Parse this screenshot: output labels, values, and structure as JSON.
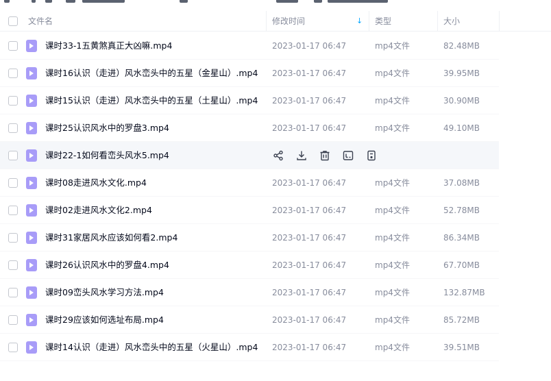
{
  "header": {
    "name_label": "文件名",
    "date_label": "修改时间",
    "sort_arrow": "↓",
    "type_label": "类型",
    "size_label": "大小"
  },
  "colors": {
    "accent": "#06a7ff",
    "video_icon": "#a89cf8",
    "row_hover": "#f5f7fa"
  },
  "hover_row_index": 4,
  "hover_actions": [
    "share-icon",
    "download-icon",
    "delete-icon",
    "rename-icon",
    "more-icon"
  ],
  "rows": [
    {
      "name": "课时33-1五黄煞真正大凶嘛.mp4",
      "date": "2023-01-17 06:47",
      "type": "mp4文件",
      "size": "82.48MB"
    },
    {
      "name": "课时16认识（走进）风水峦头中的五星（金星山）.mp4",
      "date": "2023-01-17 06:47",
      "type": "mp4文件",
      "size": "39.95MB"
    },
    {
      "name": "课时15认识（走进）风水峦头中的五星（土星山）.mp4",
      "date": "2023-01-17 06:47",
      "type": "mp4文件",
      "size": "30.90MB"
    },
    {
      "name": "课时25认识风水中的罗盘3.mp4",
      "date": "2023-01-17 06:47",
      "type": "mp4文件",
      "size": "49.10MB"
    },
    {
      "name": "课时22-1如何看峦头风水5.mp4",
      "date": "",
      "type": "",
      "size": ""
    },
    {
      "name": "课时08走进风水文化.mp4",
      "date": "2023-01-17 06:47",
      "type": "mp4文件",
      "size": "37.08MB"
    },
    {
      "name": "课时02走进风水文化2.mp4",
      "date": "2023-01-17 06:47",
      "type": "mp4文件",
      "size": "52.78MB"
    },
    {
      "name": "课时31家居风水应该如何看2.mp4",
      "date": "2023-01-17 06:47",
      "type": "mp4文件",
      "size": "86.34MB"
    },
    {
      "name": "课时26认识风水中的罗盘4.mp4",
      "date": "2023-01-17 06:47",
      "type": "mp4文件",
      "size": "67.70MB"
    },
    {
      "name": "课时09峦头风水学习方法.mp4",
      "date": "2023-01-17 06:47",
      "type": "mp4文件",
      "size": "132.87MB"
    },
    {
      "name": "课时29应该如何选址布局.mp4",
      "date": "2023-01-17 06:47",
      "type": "mp4文件",
      "size": "85.72MB"
    },
    {
      "name": "课时14认识（走进）风水峦头中的五星（火星山）.mp4",
      "date": "2023-01-17 06:47",
      "type": "mp4文件",
      "size": "39.51MB"
    }
  ]
}
